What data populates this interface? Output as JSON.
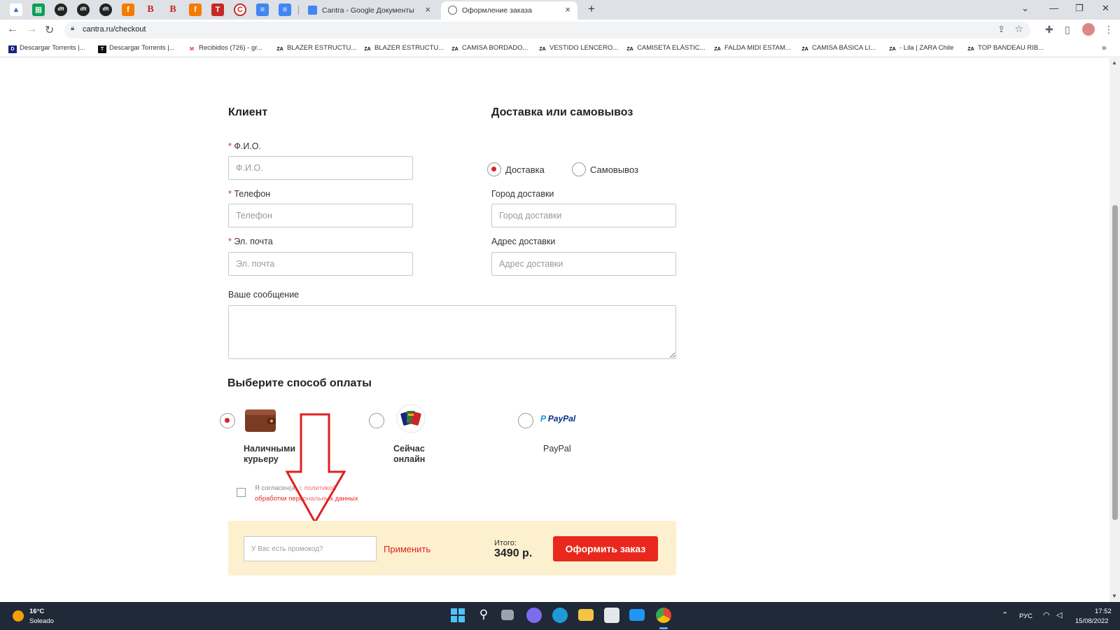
{
  "browser": {
    "tabs": [
      {
        "title": "Cantra - Google Документы"
      },
      {
        "title": "Оформление заказа"
      }
    ],
    "new_tab": "+",
    "url": "cantra.ru/checkout",
    "bookmarks": [
      "Descargar Torrents |...",
      "Descargar Torrents |...",
      "Recibidos (726) - gr...",
      "BLAZER ESTRUCTU...",
      "BLAZER ESTRUCTU...",
      "CAMISA BORDADO...",
      "VESTIDO LENCERO...",
      "CAMISETA ELÁSTIC...",
      "FALDA MIDI ESTAM...",
      "CAMISA BÁSICA LI...",
      "- Lila | ZARA Chile",
      "TOP BANDEAU RIB..."
    ]
  },
  "client": {
    "heading": "Клиент",
    "name_label": "Ф.И.О.",
    "name_placeholder": "Ф.И.О.",
    "phone_label": "Телефон",
    "phone_placeholder": "Телефон",
    "email_label": "Эл. почта",
    "email_placeholder": "Эл. почта",
    "required_mark": "*",
    "message_label": "Ваше сообщение"
  },
  "delivery": {
    "heading": "Доставка или самовывоз",
    "option_delivery": "Доставка",
    "option_pickup": "Самовывоз",
    "selected": "Доставка",
    "city_label": "Город доставки",
    "city_placeholder": "Город доставки",
    "address_label": "Адрес доставки",
    "address_placeholder": "Адрес доставки"
  },
  "payment": {
    "heading": "Выберите способ оплаты",
    "methods": [
      {
        "line1": "Наличными",
        "line2": "курьеру",
        "icon": "wallet-icon",
        "selected": true
      },
      {
        "line1": "Сейчас",
        "line2": "онлайн",
        "icon": "cards-icon",
        "selected": false
      },
      {
        "line1": "PayPal",
        "line2": "",
        "icon": "paypal-logo",
        "selected": false
      }
    ],
    "paypal_logo_text": "PayPal"
  },
  "consent": {
    "line1_prefix": "Я согласен(а) с ",
    "line1_link": "политикой",
    "line2_link": "обработки персональных данных"
  },
  "order_bar": {
    "promo_placeholder": "У Вас есть промокод?",
    "apply": "Применить",
    "total_label": "Итого:",
    "total_value": "3490 р.",
    "submit": "Оформить заказ"
  },
  "taskbar": {
    "temperature": "16°C",
    "weather": "Soleado",
    "language": "РУС",
    "time": "17:52",
    "date": "15/08/2022"
  },
  "colors": {
    "accent": "#e8281c",
    "promo_bar": "#fdf0cf",
    "annotation_arrow": "#e02020"
  }
}
